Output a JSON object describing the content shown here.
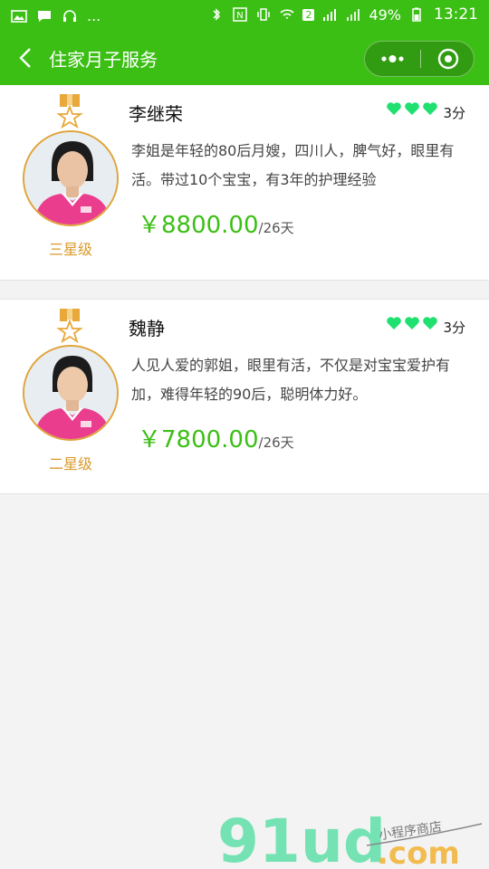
{
  "status_bar": {
    "battery": "49%",
    "time": "13:21",
    "sim_badge": "2",
    "notification_dots": "..."
  },
  "nav": {
    "back_icon": "chevron-left-icon",
    "title": "住家月子服务",
    "capsule": {
      "more_icon": "more-dots-icon",
      "close_icon": "target-close-icon"
    }
  },
  "nannies": [
    {
      "name": "李继荣",
      "level": "三星级",
      "rating_hearts": 3,
      "score": "3分",
      "description": "李姐是年轻的80后月嫂，四川人，脾气好，眼里有活。带过10个宝宝，有3年的护理经验",
      "price": "￥8800.00",
      "unit": "/26天"
    },
    {
      "name": "魏静",
      "level": "二星级",
      "rating_hearts": 3,
      "score": "3分",
      "description": "人见人爱的郭姐，眼里有活，不仅是对宝宝爱护有加，难得年轻的90后，聪明体力好。",
      "price": "￥7800.00",
      "unit": "/26天"
    }
  ],
  "colors": {
    "brand_green": "#3cbf15",
    "heart_green": "#20e070",
    "gold": "#d99a2b"
  },
  "watermark": {
    "logo_text": "91ud.com",
    "tagline": "小程序商店"
  }
}
